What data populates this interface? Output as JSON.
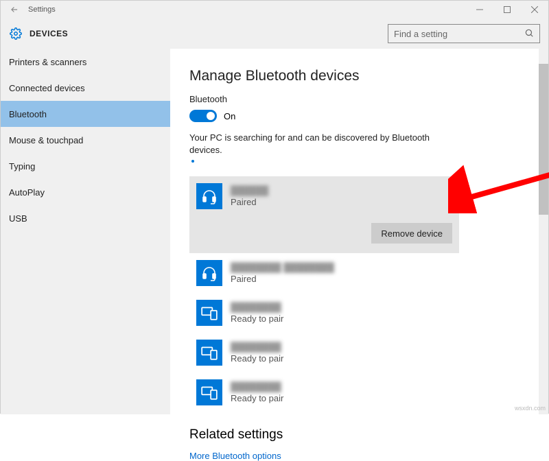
{
  "titlebar": {
    "title": "Settings"
  },
  "header": {
    "title": "DEVICES"
  },
  "search": {
    "placeholder": "Find a setting"
  },
  "sidebar": {
    "items": [
      {
        "label": "Printers & scanners",
        "selected": false
      },
      {
        "label": "Connected devices",
        "selected": false
      },
      {
        "label": "Bluetooth",
        "selected": true
      },
      {
        "label": "Mouse & touchpad",
        "selected": false
      },
      {
        "label": "Typing",
        "selected": false
      },
      {
        "label": "AutoPlay",
        "selected": false
      },
      {
        "label": "USB",
        "selected": false
      }
    ]
  },
  "main": {
    "title": "Manage Bluetooth devices",
    "bluetooth_label": "Bluetooth",
    "toggle_state": "On",
    "note": "Your PC is searching for and can be discovered by Bluetooth devices.",
    "devices": [
      {
        "name": "██████",
        "status": "Paired",
        "icon": "headset",
        "selected": true,
        "remove_label": "Remove device"
      },
      {
        "name": "████████ ████████",
        "status": "Paired",
        "icon": "headset",
        "selected": false
      },
      {
        "name": "████████",
        "status": "Ready to pair",
        "icon": "device",
        "selected": false
      },
      {
        "name": "████████",
        "status": "Ready to pair",
        "icon": "device",
        "selected": false
      },
      {
        "name": "████████",
        "status": "Ready to pair",
        "icon": "device",
        "selected": false
      }
    ],
    "related_title": "Related settings",
    "related_link": "More Bluetooth options"
  },
  "watermark": "wsxdn.com"
}
